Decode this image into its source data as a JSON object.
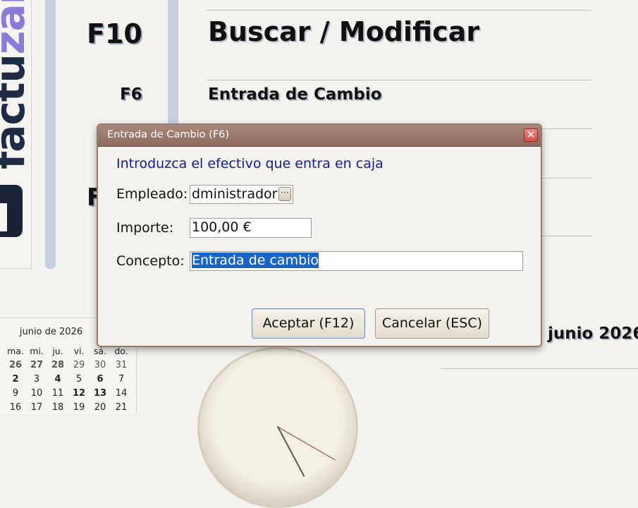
{
  "background": {
    "logo_text_dark": "factu",
    "logo_text_accent": "zan",
    "shortcut_f10": "F10",
    "shortcut_f6": "F6",
    "shortcut_partial": "F",
    "menu_f10_label": "Buscar / Modificar",
    "menu_f6_label": "Entrada de Cambio",
    "date_label": "junio 2026"
  },
  "calendar": {
    "title": "junio de 2026",
    "weekdays": [
      "ma.",
      "mi.",
      "ju.",
      "vi.",
      "sá.",
      "do."
    ],
    "rows": [
      [
        "26",
        "27",
        "28",
        "29",
        "30",
        "31"
      ],
      [
        "2",
        "3",
        "4",
        "5",
        "6",
        "7"
      ],
      [
        "9",
        "10",
        "11",
        "12",
        "13",
        "14"
      ],
      [
        "16",
        "17",
        "18",
        "19",
        "20",
        "21"
      ]
    ]
  },
  "dialog": {
    "title": "Entrada de Cambio (F6)",
    "close_glyph": "✕",
    "intro": "Introduzca el efectivo que entra en caja",
    "empleado_label": "Empleado:",
    "empleado_value": "dministrador",
    "empleado_button": "···",
    "importe_label": "Importe:",
    "importe_value": "100,00 €",
    "concepto_label": "Concepto:",
    "concepto_value": "Entrada de cambio",
    "accept_label": "Aceptar (F12)",
    "cancel_label": "Cancelar (ESC)"
  },
  "colors": {
    "accent_blue": "#1a1a8a",
    "selection": "#1864c8",
    "titlebar": "#8d6a5c"
  }
}
